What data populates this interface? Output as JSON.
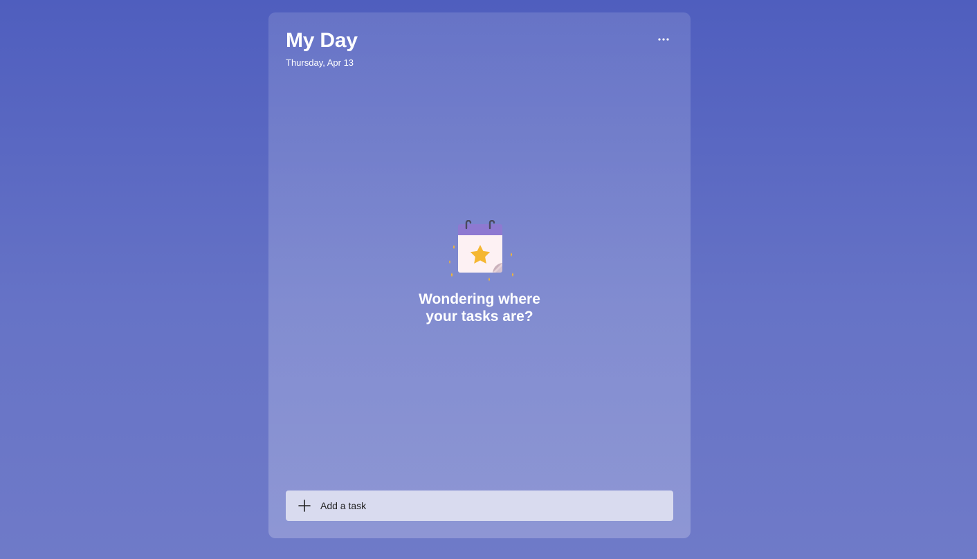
{
  "header": {
    "title": "My Day",
    "date": "Thursday, Apr 13",
    "more_icon": "more-horizontal-icon"
  },
  "empty_state": {
    "illustration_icon": "calendar-star-icon",
    "message": "Wondering where\nyour tasks are?"
  },
  "add_task": {
    "icon": "plus-icon",
    "label": "Add a task"
  },
  "colors": {
    "background": "#5260bf",
    "accent_purple": "#8e79d1",
    "star": "#f5b731",
    "input_background": "#d9dbef"
  }
}
